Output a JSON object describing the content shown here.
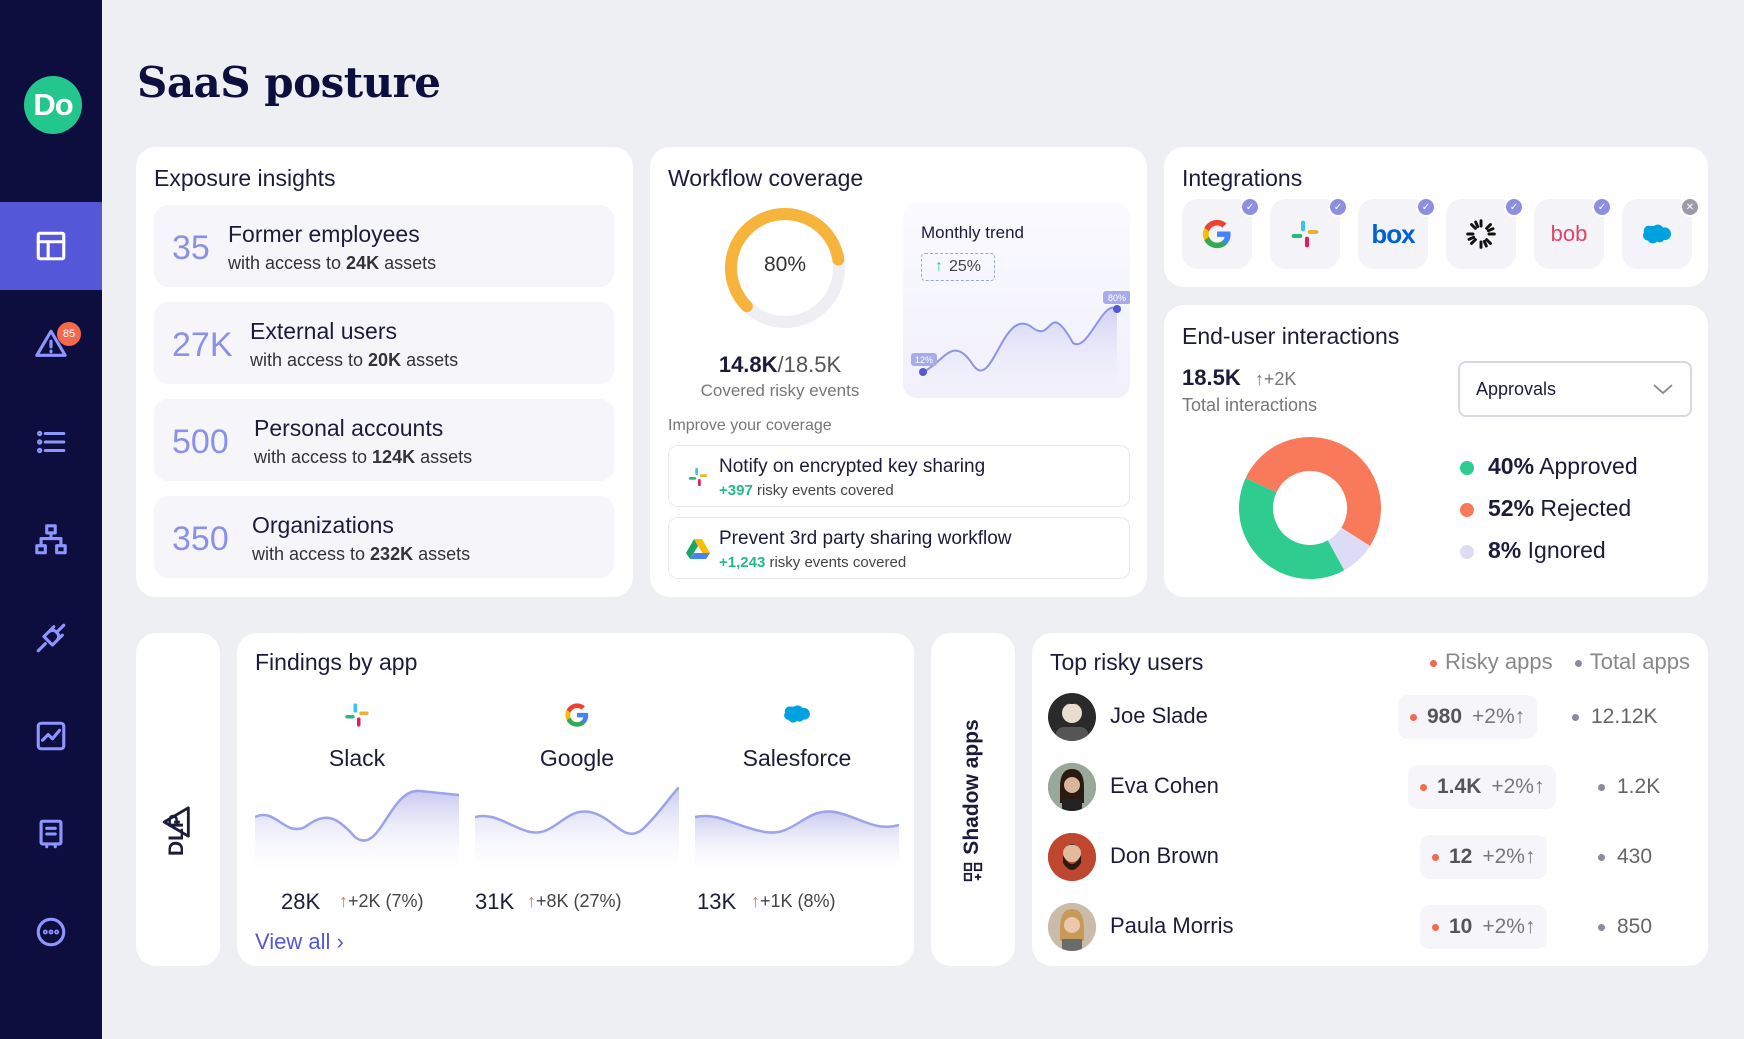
{
  "page": {
    "title": "SaaS posture"
  },
  "logo": {
    "text": "Do"
  },
  "sidebar": {
    "alert_count": "85"
  },
  "exposure": {
    "title": "Exposure insights",
    "rows": [
      {
        "num": "35",
        "label": "Former employees",
        "pre": "with access to ",
        "bold": "24K",
        "post": " assets"
      },
      {
        "num": "27K",
        "label": "External users",
        "pre": "with access to ",
        "bold": "20K",
        "post": " assets"
      },
      {
        "num": "500",
        "label": "Personal accounts",
        "pre": "with access to ",
        "bold": "124K",
        "post": " assets"
      },
      {
        "num": "350",
        "label": "Organizations",
        "pre": "with access to ",
        "bold": "232K",
        "post": " assets"
      }
    ]
  },
  "workflow": {
    "title": "Workflow coverage",
    "gauge_pct": "80%",
    "gauge_value": 0.8,
    "covered": "14.8K",
    "total": "/18.5K",
    "covered_label": "Covered risky events",
    "trend_title": "Monthly trend",
    "trend_delta": "25%",
    "trend_start": "12%",
    "trend_end": "80%",
    "improve_label": "Improve your coverage",
    "items": [
      {
        "title": "Notify on encrypted key sharing",
        "plus": "+397",
        "rest": " risky events covered",
        "icon": "slack-icon"
      },
      {
        "title": "Prevent 3rd party sharing workflow",
        "plus": "+1,243",
        "rest": " risky events covered",
        "icon": "google-drive-icon"
      }
    ]
  },
  "integrations": {
    "title": "Integrations",
    "items": [
      {
        "name": "google-icon",
        "status": "connected"
      },
      {
        "name": "slack-icon",
        "status": "connected"
      },
      {
        "name": "box-icon",
        "status": "connected",
        "text": "box"
      },
      {
        "name": "openai-icon",
        "status": "connected"
      },
      {
        "name": "bob-icon",
        "status": "connected",
        "text": "bob"
      },
      {
        "name": "salesforce-icon",
        "status": "disconnected"
      }
    ]
  },
  "end_user": {
    "title": "End-user interactions",
    "total": "18.5K",
    "delta": "+2K",
    "total_label": "Total interactions",
    "dropdown": "Approvals",
    "legend": [
      {
        "pct": "40%",
        "label": " Approved",
        "color": "#2ecc8f",
        "value": 40
      },
      {
        "pct": "52%",
        "label": " Rejected",
        "color": "#f97a5a",
        "value": 52
      },
      {
        "pct": "8%",
        "label": " Ignored",
        "color": "#dcdcf7",
        "value": 8
      }
    ]
  },
  "dlp": {
    "label": "DLP"
  },
  "findings": {
    "title": "Findings by app",
    "apps": [
      {
        "name": "Slack",
        "value": "28K",
        "delta": "+2K (7%)"
      },
      {
        "name": "Google",
        "value": "31K",
        "delta": "+8K (27%)"
      },
      {
        "name": "Salesforce",
        "value": "13K",
        "delta": "+1K (8%)"
      }
    ],
    "view_all": "View all"
  },
  "shadow": {
    "label": "Shadow apps"
  },
  "risky": {
    "title": "Top risky users",
    "legend_risky": "Risky apps",
    "legend_total": "Total apps",
    "users": [
      {
        "name": "Joe Slade",
        "risky": "980",
        "delta": "+2%",
        "total": "12.12K"
      },
      {
        "name": "Eva Cohen",
        "risky": "1.4K",
        "delta": "+2%",
        "total": "1.2K"
      },
      {
        "name": "Don Brown",
        "risky": "12",
        "delta": "+2%",
        "total": "430"
      },
      {
        "name": "Paula Morris",
        "risky": "10",
        "delta": "+2%",
        "total": "850"
      }
    ]
  }
}
